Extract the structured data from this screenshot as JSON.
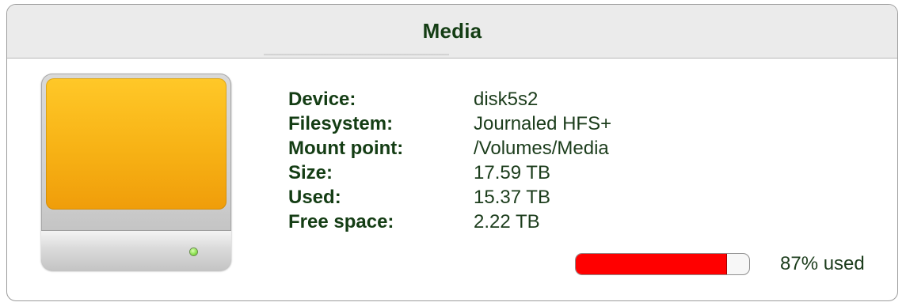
{
  "panel": {
    "title": "Media"
  },
  "drive_icon": "external-drive-icon",
  "details": [
    {
      "label": "Device:",
      "value": "disk5s2"
    },
    {
      "label": "Filesystem:",
      "value": "Journaled HFS+"
    },
    {
      "label": "Mount point:",
      "value": "/Volumes/Media"
    },
    {
      "label": "Size:",
      "value": "17.59 TB"
    },
    {
      "label": "Used:",
      "value": "15.37 TB"
    },
    {
      "label": "Free space:",
      "value": "2.22 TB"
    }
  ],
  "usage": {
    "percent_used": 87,
    "text": "87% used"
  },
  "colors": {
    "label": "#143d14",
    "usage_fill": "#ff0000",
    "drive_face": "#f7b215"
  }
}
